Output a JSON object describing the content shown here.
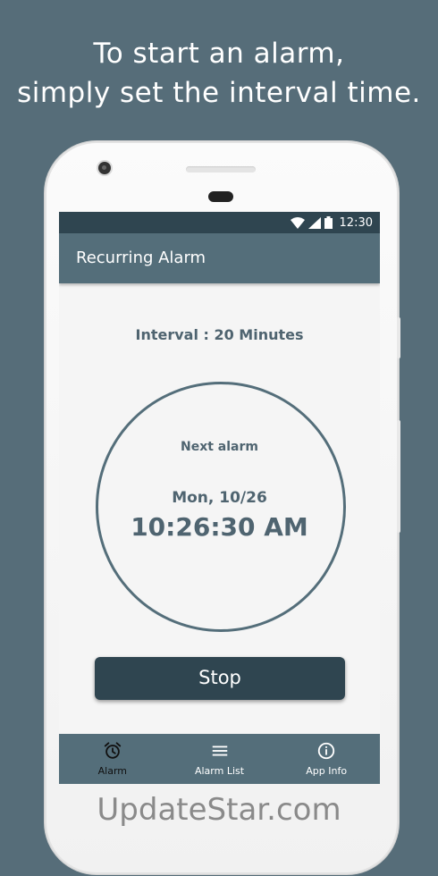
{
  "headline": {
    "line1": "To start an alarm,",
    "line2": "simply set the interval time."
  },
  "status_bar": {
    "time": "12:30",
    "icons": [
      "wifi-icon",
      "signal-icon",
      "battery-icon"
    ]
  },
  "app_bar": {
    "title": "Recurring Alarm"
  },
  "main": {
    "interval_text": "Interval : 20 Minutes",
    "next_alarm_label": "Next alarm",
    "next_alarm_date": "Mon, 10/26",
    "next_alarm_time": "10:26:30 AM",
    "stop_label": "Stop"
  },
  "bottom_nav": {
    "items": [
      {
        "label": "Alarm",
        "icon": "alarm-clock-icon",
        "active": true
      },
      {
        "label": "Alarm List",
        "icon": "list-icon",
        "active": false
      },
      {
        "label": "App Info",
        "icon": "info-icon",
        "active": false
      }
    ]
  },
  "watermark": "UpdateStar.com",
  "colors": {
    "background": "#566d79",
    "primary": "#546e7a",
    "primary_dark": "#2f4550",
    "screen_bg": "#f5f5f5",
    "text": "#4f6470"
  }
}
